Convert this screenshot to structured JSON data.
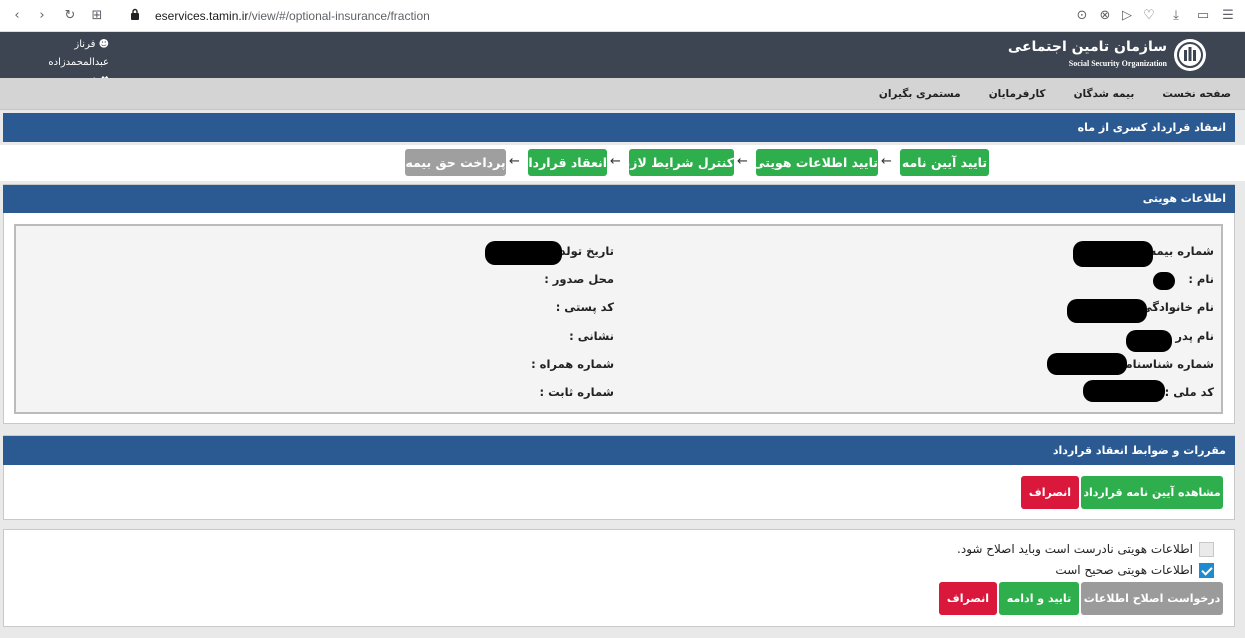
{
  "browser": {
    "url_domain": "eservices.tamin.ir",
    "url_path": "/view/#/optional-insurance/fraction"
  },
  "header": {
    "user_name": "فرناز عبدالمحمدزاده",
    "logout_label": "خروج",
    "logo_fa": "سازمان تامین اجتماعی",
    "logo_en": "Social Security Organization"
  },
  "nav": {
    "items": [
      "صفحه نخست",
      "بیمه شدگان",
      "کارفرمایان",
      "مستمری بگیران"
    ]
  },
  "page_title": "انعقاد قرارداد کسری از ماه",
  "steps": [
    {
      "label": "تایید آیین نامه",
      "state": "done"
    },
    {
      "label": "تایید اطلاعات هویتی",
      "state": "done"
    },
    {
      "label": "کنترل شرایط لازم",
      "state": "done"
    },
    {
      "label": "انعقاد قرارداد",
      "state": "done"
    },
    {
      "label": "پرداخت حق بیمه",
      "state": "pending"
    }
  ],
  "identity": {
    "section_title": "اطلاعات هویتی",
    "right_fields": [
      "شماره بیمه :",
      "نام :",
      "نام خانوادگی :",
      "نام پدر :",
      "شماره شناسنامه :",
      "کد ملی :"
    ],
    "left_fields": [
      "تاریخ تولد",
      "محل صدور :",
      "کد پستی :",
      "نشانی :",
      "شماره همراه :",
      "شماره ثابت :"
    ]
  },
  "rules": {
    "section_title": "مقررات و ضوابط انعقاد قرارداد",
    "view_button": "مشاهده آیین نامه قرارداد",
    "cancel_button": "انصراف"
  },
  "confirm": {
    "option_incorrect": "اطلاعات هویتی نادرست است وباید اصلاح شود.",
    "option_correct": "اطلاعات هویتی صحیح است",
    "correct_checked": true,
    "request_fix_button": "درخواست اصلاح اطلاعات",
    "continue_button": "تایید و ادامه",
    "cancel_button": "انصراف"
  },
  "colors": {
    "header_bg": "#3c4551",
    "section_blue": "#2b5a93",
    "success_green": "#2eae4c",
    "danger_red": "#d9183b",
    "disabled_gray": "#9f9f9f"
  }
}
